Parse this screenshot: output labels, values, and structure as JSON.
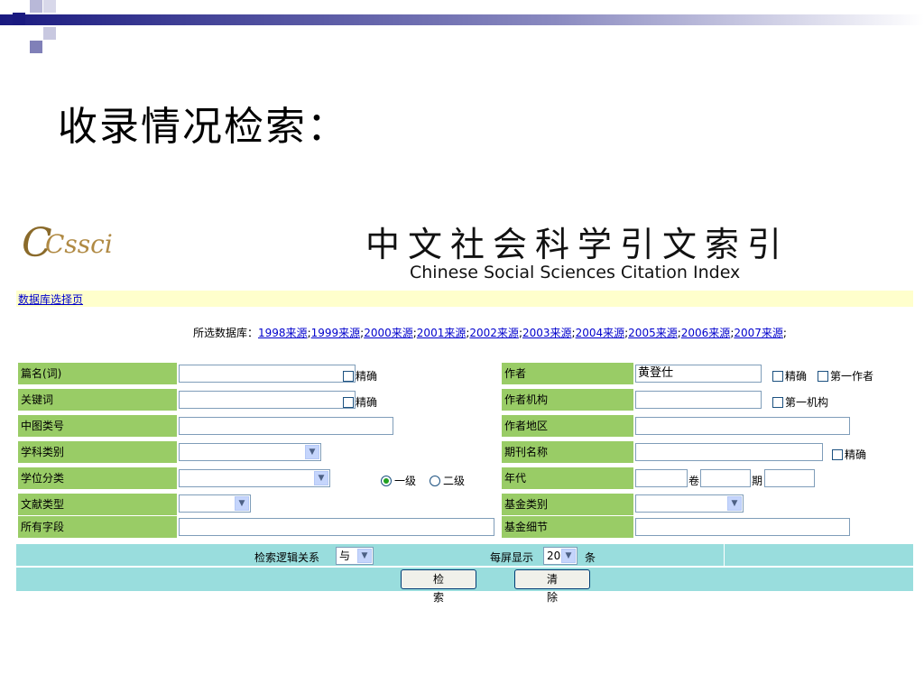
{
  "slide_title": "收录情况检索：",
  "logo_text": "Cssci",
  "header": {
    "chinese_title": "中文社会科学引文索引",
    "english_title": "Chinese Social Sciences Citation Index"
  },
  "nav_link": "数据库选择页",
  "db_prefix": "所选数据库：",
  "db_sources": [
    "1998来源",
    "1999来源",
    "2000来源",
    "2001来源",
    "2002来源",
    "2003来源",
    "2004来源",
    "2005来源",
    "2006来源",
    "2007来源"
  ],
  "left_fields": {
    "title_words": "篇名(词)",
    "keywords": "关键词",
    "clc_number": "中图类号",
    "subject_category": "学科类别",
    "degree_category": "学位分类",
    "doc_type": "文献类型",
    "all_fields": "所有字段"
  },
  "right_fields": {
    "author": "作者",
    "author_org": "作者机构",
    "author_region": "作者地区",
    "journal_name": "期刊名称",
    "year": "年代",
    "fund_category": "基金类别",
    "fund_detail": "基金细节"
  },
  "author_value": "黄登仕",
  "checkbox_exact": "精确",
  "checkbox_first_author": "第一作者",
  "checkbox_first_org": "第一机构",
  "radio_level1": "一级",
  "radio_level2": "二级",
  "volume_label": "卷",
  "issue_label": "期",
  "logic_label": "检索逻辑关系",
  "logic_value": "与",
  "per_page_label": "每屏显示",
  "per_page_value": "20",
  "per_page_unit": "条",
  "search_button": "检 索",
  "clear_button": "清 除"
}
